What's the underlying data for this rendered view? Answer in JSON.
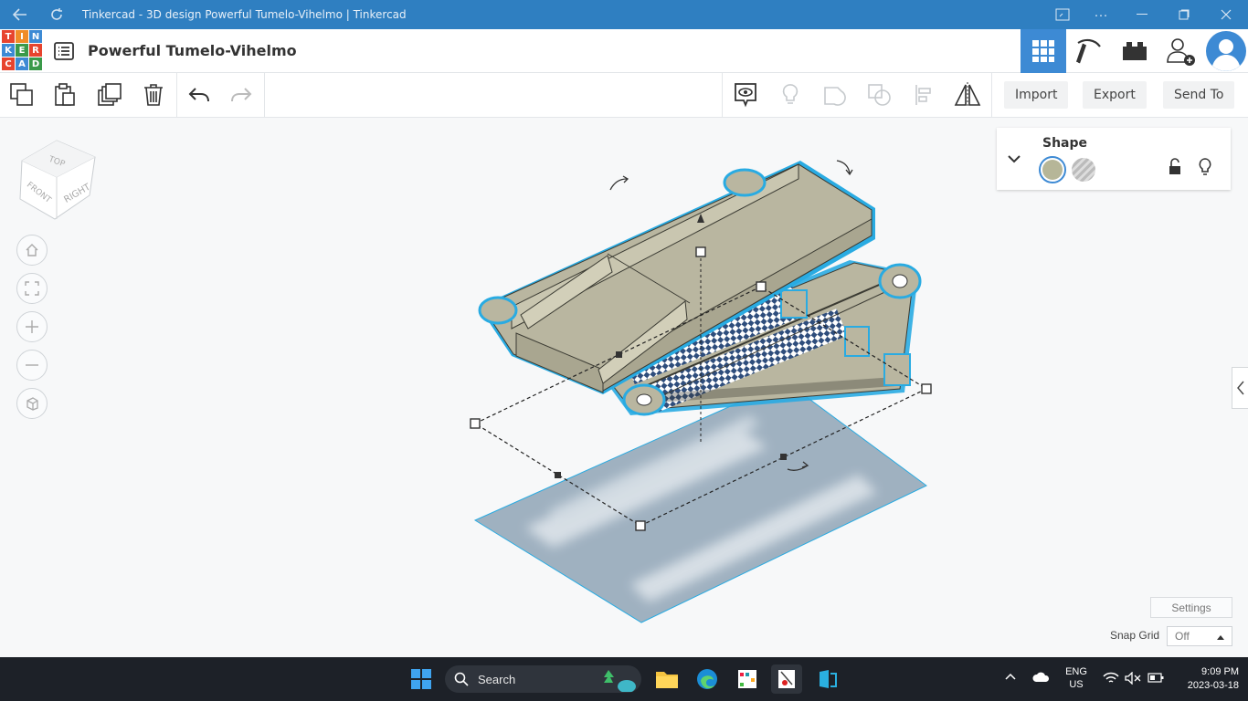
{
  "window": {
    "title": "Tinkercad - 3D design Powerful Tumelo-Vihelmo | Tinkercad"
  },
  "logo": {
    "letters": [
      "T",
      "I",
      "N",
      "K",
      "E",
      "R",
      "C",
      "A",
      "D"
    ]
  },
  "header": {
    "design_title": "Powerful Tumelo-Vihelmo"
  },
  "toolbar": {
    "import_label": "Import",
    "export_label": "Export",
    "sendto_label": "Send To"
  },
  "viewcube": {
    "top": "TOP",
    "front": "FRONT",
    "right": "RIGHT"
  },
  "shape_panel": {
    "title": "Shape",
    "solid_color": "#b6b698"
  },
  "settings": {
    "settings_label": "Settings",
    "snap_grid_label": "Snap Grid",
    "snap_grid_value": "Off"
  },
  "taskbar": {
    "search_label": "Search",
    "lang_top": "ENG",
    "lang_bottom": "US",
    "time": "9:09 PM",
    "date": "2023-03-18"
  },
  "colors": {
    "titlebar": "#2f7fc1",
    "accent": "#3d8ad4",
    "model_fill": "#b9b6a0",
    "selection_outline": "#29abe2",
    "workplane": "#9aaebd"
  }
}
